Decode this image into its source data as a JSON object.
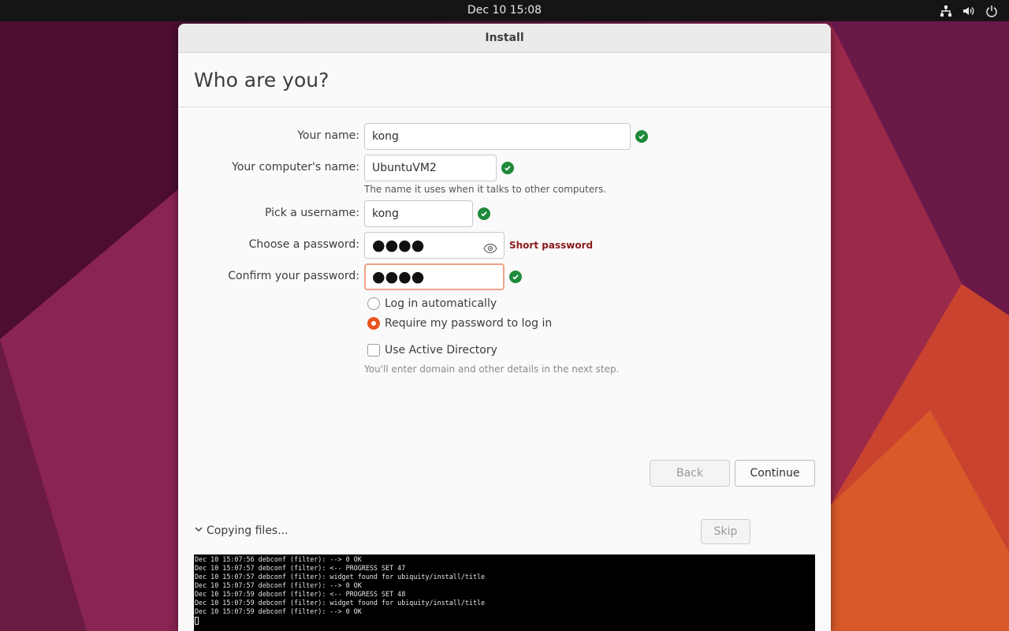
{
  "topbar": {
    "clock": "Dec 10  15:08",
    "tray_icons": [
      "network-icon",
      "volume-icon",
      "power-icon"
    ]
  },
  "window": {
    "title": "Install"
  },
  "page": {
    "title": "Who are you?"
  },
  "form": {
    "name_label": "Your name:",
    "name_value": "kong",
    "computer_label": "Your computer's name:",
    "computer_value": "UbuntuVM2",
    "computer_hint": "The name it uses when it talks to other computers.",
    "username_label": "Pick a username:",
    "username_value": "kong",
    "password_label": "Choose a password:",
    "password_value": "●●●●",
    "password_warning": "Short password",
    "confirm_label": "Confirm your password:",
    "confirm_value": "●●●●",
    "login_auto_label": "Log in automatically",
    "login_auto_selected": false,
    "require_password_label": "Require my password to log in",
    "require_password_selected": true,
    "active_directory_label": "Use Active Directory",
    "active_directory_checked": false,
    "active_directory_hint": "You'll enter domain and other details in the next step."
  },
  "buttons": {
    "back": "Back",
    "continue": "Continue",
    "skip": "Skip"
  },
  "progress": {
    "label": "Copying files..."
  },
  "terminal": {
    "lines": [
      "Dec 10 15:07:56 debconf (filter): --> 0 OK",
      "Dec 10 15:07:57 debconf (filter): <-- PROGRESS SET 47",
      "Dec 10 15:07:57 debconf (filter): widget found for ubiquity/install/title",
      "Dec 10 15:07:57 debconf (filter): --> 0 OK",
      "Dec 10 15:07:59 debconf (filter): <-- PROGRESS SET 48",
      "Dec 10 15:07:59 debconf (filter): widget found for ubiquity/install/title",
      "Dec 10 15:07:59 debconf (filter): --> 0 OK"
    ]
  },
  "colors": {
    "accent": "#e95420",
    "success": "#1f8a3a",
    "warning": "#8b1a1a"
  }
}
